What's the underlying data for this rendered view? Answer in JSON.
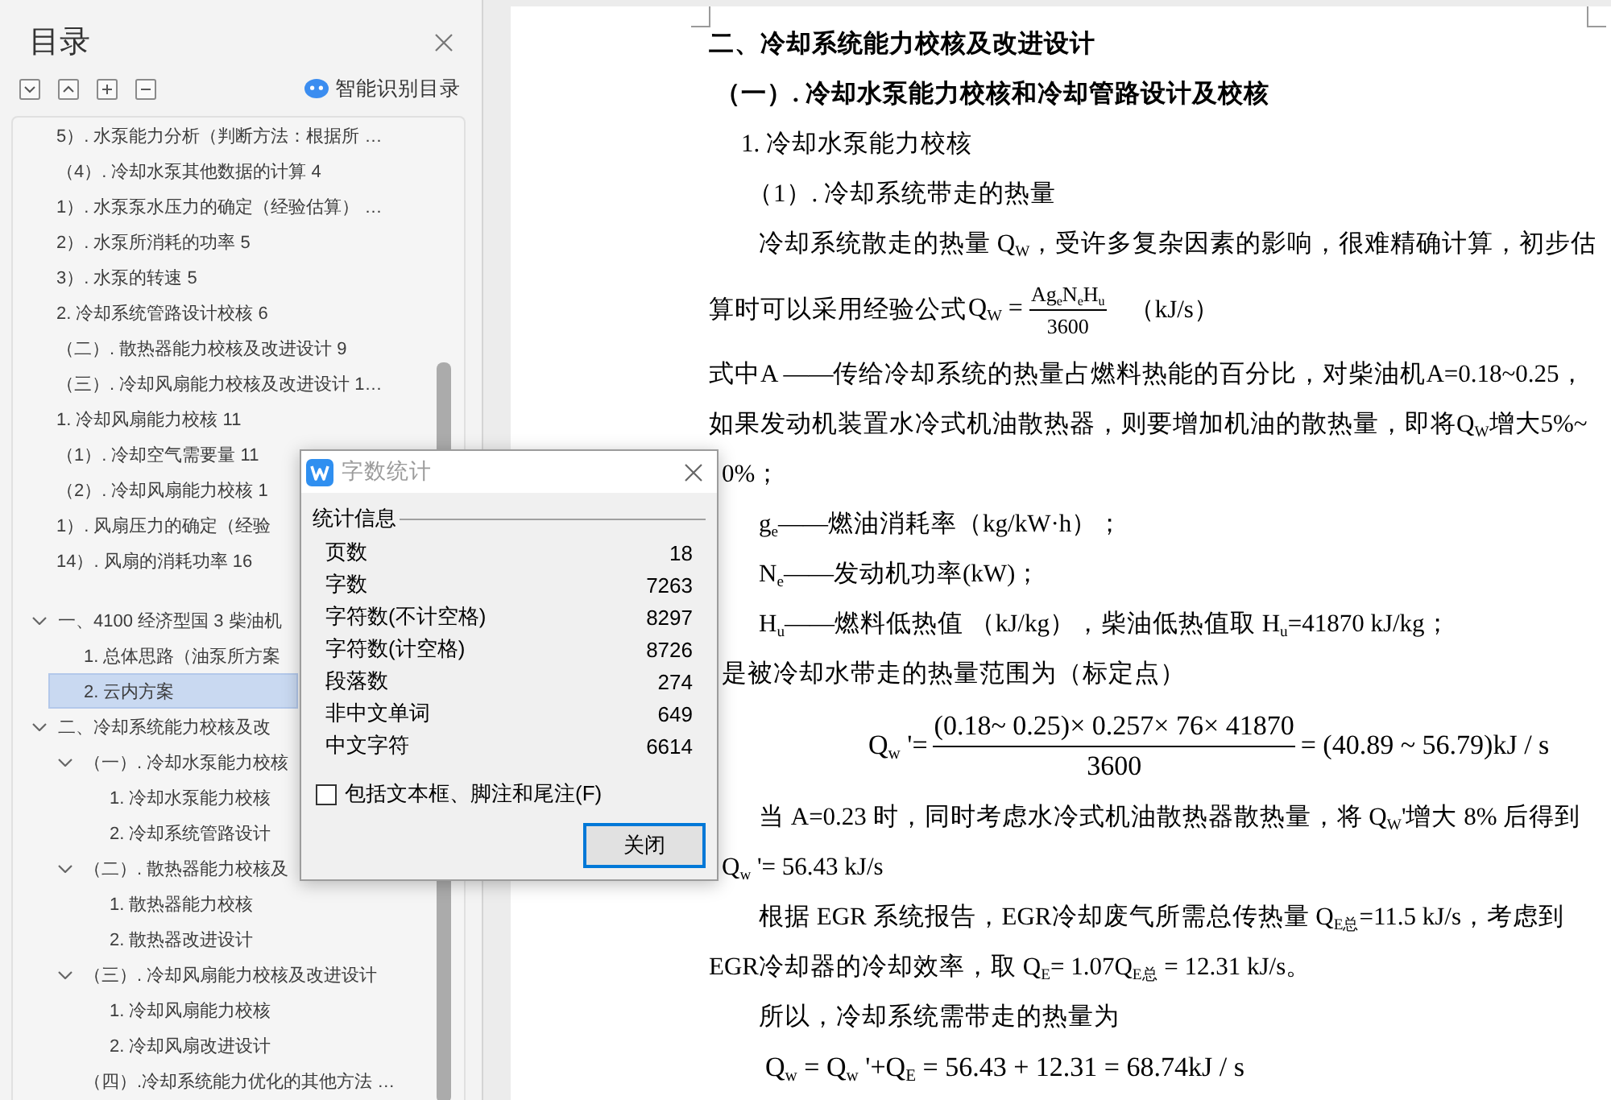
{
  "toc_panel": {
    "title": "目录",
    "smart_button": "智能识别目录",
    "flat_items": [
      {
        "text": "5）. 水泵能力分析（判断方法：根据所 …",
        "selected": false
      },
      {
        "text": "（4）. 冷却水泵其他数据的计算 4",
        "selected": false
      },
      {
        "text": "1）. 水泵泵水压力的确定（经验估算） …",
        "selected": false
      },
      {
        "text": "2）. 水泵所消耗的功率 5",
        "selected": false
      },
      {
        "text": "3）. 水泵的转速 5",
        "selected": false
      },
      {
        "text": "2. 冷却系统管路设计校核 6",
        "selected": false
      },
      {
        "text": "（二）. 散热器能力校核及改进设计 9",
        "selected": false
      },
      {
        "text": "（三）. 冷却风扇能力校核及改进设计 1…",
        "selected": false
      },
      {
        "text": "1. 冷却风扇能力校核 11",
        "selected": false
      },
      {
        "text": "（1）. 冷却空气需要量 11",
        "selected": false
      },
      {
        "text": "（2）. 冷却风扇能力校核 1",
        "selected": false
      },
      {
        "text": "1）. 风扇压力的确定（经验",
        "selected": false
      },
      {
        "text": "14）. 风扇的消耗功率 16",
        "selected": false
      }
    ],
    "tree": [
      {
        "text": "一、4100 经济型国 3 柴油机",
        "expanded": true,
        "selected": false,
        "children": [
          {
            "text": "1. 总体思路（油泵所方案",
            "selected": false
          },
          {
            "text": "2. 云内方案",
            "selected": true
          }
        ]
      },
      {
        "text": "二、冷却系统能力校核及改",
        "expanded": true,
        "selected": false,
        "children": [
          {
            "text": "（一）. 冷却水泵能力校核",
            "expanded": true,
            "selected": false,
            "children": [
              {
                "text": "1. 冷却水泵能力校核",
                "selected": false
              },
              {
                "text": "2. 冷却系统管路设计",
                "selected": false
              }
            ]
          },
          {
            "text": "（二）. 散热器能力校核及",
            "expanded": true,
            "selected": false,
            "children": [
              {
                "text": "1. 散热器能力校核",
                "selected": false
              },
              {
                "text": "2. 散热器改进设计",
                "selected": false
              }
            ]
          },
          {
            "text": "（三）. 冷却风扇能力校核及改进设计",
            "expanded": true,
            "selected": false,
            "children": [
              {
                "text": "1. 冷却风扇能力校核",
                "selected": false
              },
              {
                "text": "2. 冷却风扇改进设计",
                "selected": false
              }
            ]
          },
          {
            "text": "（四）.冷却系统能力优化的其他方法 …",
            "selected": false
          }
        ]
      }
    ]
  },
  "word_count_dialog": {
    "title": "字数统计",
    "section": "统计信息",
    "stats": [
      {
        "label": "页数",
        "value": "18"
      },
      {
        "label": "字数",
        "value": "7263"
      },
      {
        "label": "字符数(不计空格)",
        "value": "8297"
      },
      {
        "label": "字符数(计空格)",
        "value": "8726"
      },
      {
        "label": "段落数",
        "value": "274"
      },
      {
        "label": "非中文单词",
        "value": "649"
      },
      {
        "label": "中文字符",
        "value": "6614"
      }
    ],
    "checkbox": {
      "label": "包括文本框、脚注和尾注(F)",
      "checked": false
    },
    "close_button": {
      "label": "关闭",
      "focused": true
    }
  },
  "document": {
    "lines": [
      {
        "kind": "h1",
        "text": "二、冷却系统能力校核及改进设计"
      },
      {
        "kind": "h2",
        "text": "（一）. 冷却水泵能力校核和冷却管路设计及校核"
      },
      {
        "kind": "h3",
        "text": "1. 冷却水泵能力校核"
      },
      {
        "kind": "h4",
        "text": "（1）. 冷却系统带走的热量"
      },
      {
        "kind": "body-indent",
        "text": "冷却系统散走的热量 Q$_{W}$，受许多复杂因素的影响，很难精确计算，初步估"
      },
      {
        "kind": "fraction-inline",
        "text": "算时可以采用经验公式",
        "lhs": "Q$_{W}$ =",
        "numerator": "Ag$_{e}$N$_{e}$H$_{u}$",
        "denominator": "3600",
        "tail": "（kJ/s）"
      },
      {
        "kind": "body",
        "text": "式中A ——传给冷却系统的热量占燃料热能的百分比，对柴油机A=0.18~0.25，"
      },
      {
        "kind": "body",
        "text": "如果发动机装置水冷式机油散热器，则要增加机油的散热量，即将Q$_{W}$增大5%~"
      },
      {
        "kind": "tail",
        "text": "0%；"
      },
      {
        "kind": "body-indent",
        "text": "g$_{e}$——燃油消耗率（kg/kW·h）；"
      },
      {
        "kind": "body-indent",
        "text": "N$_{e}$——发动机功率(kW)；"
      },
      {
        "kind": "body-indent",
        "text": "H$_{u}$——燃料低热值 （kJ/kg），柴油低热值取 H$_{u}$=41870 kJ/kg；"
      },
      {
        "kind": "tail",
        "text": "是被冷却水带走的热量范围为（标定点）"
      },
      {
        "kind": "fraction-display",
        "lhs": "Q$_{w}$ '=",
        "numerator": "(0.18~ 0.25)× 0.257× 76× 41870",
        "denominator": "3600",
        "rhs": "= (40.89 ~ 56.79)kJ / s"
      },
      {
        "kind": "body-indent",
        "text": "当 A=0.23 时，同时考虑水冷式机油散热器散热量，将 Q$_{W}$'增大 8% 后得到"
      },
      {
        "kind": "tail",
        "text": "Q$_{w}$ '= 56.43 kJ/s"
      },
      {
        "kind": "body-indent",
        "text": "根据 EGR 系统报告，EGR冷却废气所需总传热量 Q$_{E总}$=11.5 kJ/s，考虑到"
      },
      {
        "kind": "body",
        "text": "EGR冷却器的冷却效率，取 Q$_{E}$= 1.07Q$_{E总}$ = 12.31 kJ/s。"
      },
      {
        "kind": "body-indent",
        "text": "所以，冷却系统需带走的热量为"
      },
      {
        "kind": "formula",
        "text": "Q$_{w}$ = Q$_{w}$ '+Q$_{E}$ = 56.43 + 12.31 = 68.74kJ / s"
      }
    ]
  }
}
